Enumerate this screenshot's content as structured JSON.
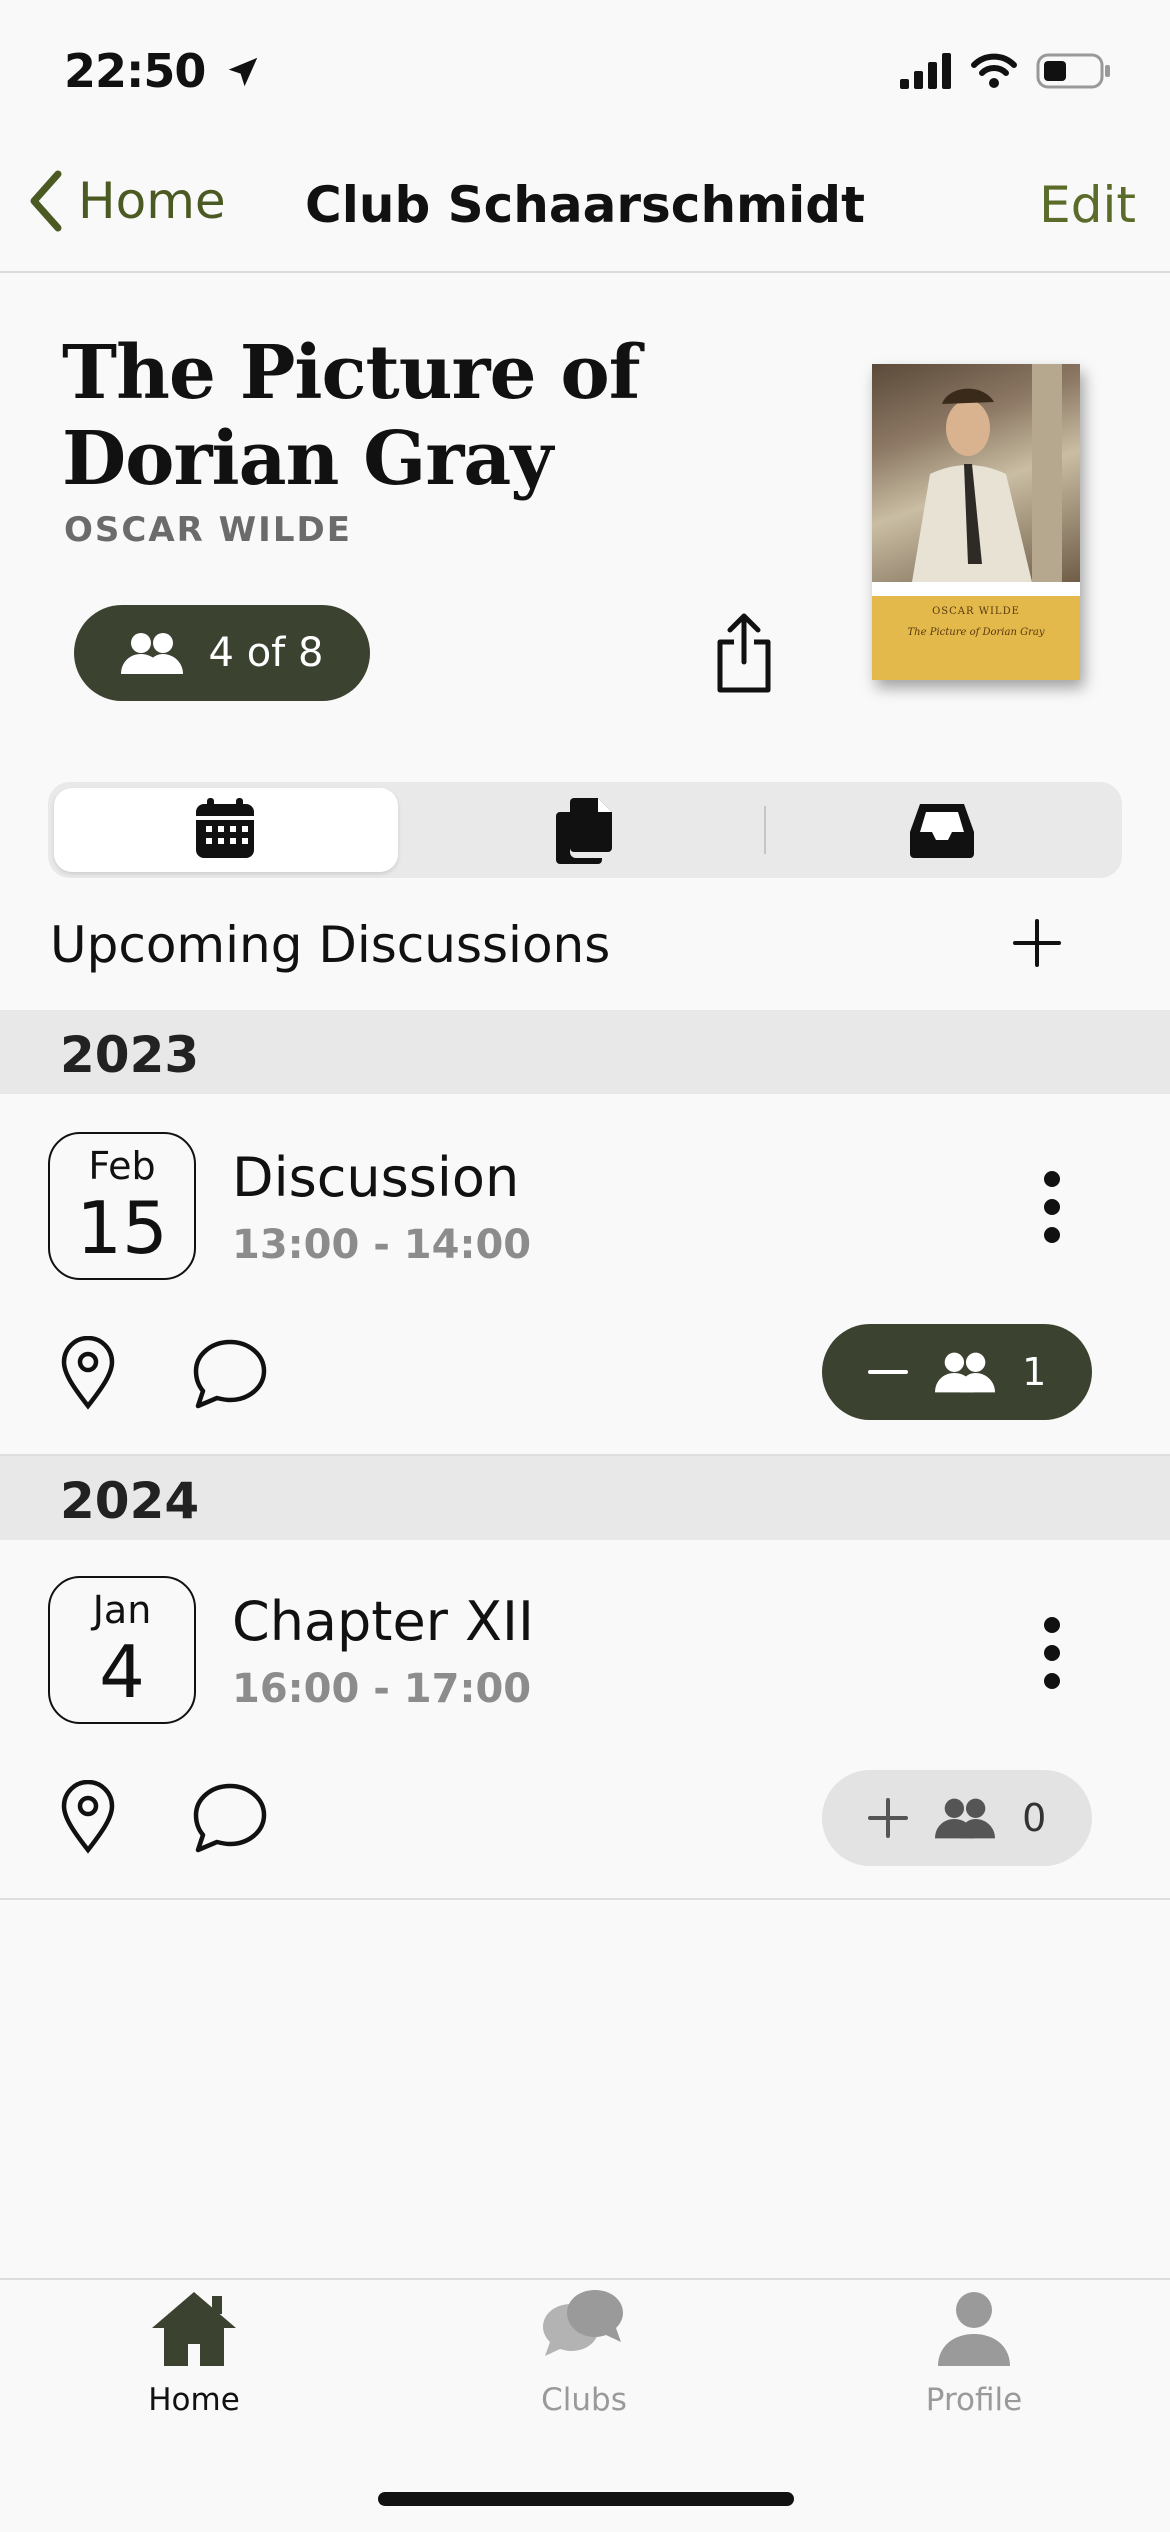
{
  "status_bar": {
    "time": "22:50"
  },
  "nav": {
    "back_label": "Home",
    "title": "Club Schaarschmidt",
    "edit_label": "Edit"
  },
  "book": {
    "title": "The Picture of Dorian Gray",
    "author": "OSCAR WILDE",
    "members": "4 of 8",
    "cover_author": "OSCAR WILDE",
    "cover_title": "The Picture of Dorian Gray",
    "cover_color": "#e2b94a"
  },
  "segments": [
    "calendar-icon",
    "documents-icon",
    "inbox-icon"
  ],
  "section": {
    "title": "Upcoming Discussions"
  },
  "years": [
    {
      "year": "2023",
      "events": [
        {
          "month": "Feb",
          "day": "15",
          "title": "Discussion",
          "time": "13:00 - 14:00",
          "attendees": "1",
          "attending": true
        }
      ]
    },
    {
      "year": "2024",
      "events": [
        {
          "month": "Jan",
          "day": "4",
          "title": "Chapter XII",
          "time": "16:00 - 17:00",
          "attendees": "0",
          "attending": false
        }
      ]
    }
  ],
  "tabs": [
    {
      "label": "Home",
      "icon": "house-icon",
      "active": true
    },
    {
      "label": "Clubs",
      "icon": "chat-bubbles-icon",
      "active": false
    },
    {
      "label": "Profile",
      "icon": "person-icon",
      "active": false
    }
  ],
  "colors": {
    "accent": "#3b4230",
    "link": "#4a5a22",
    "inactive_tab": "#9a9a9a"
  }
}
